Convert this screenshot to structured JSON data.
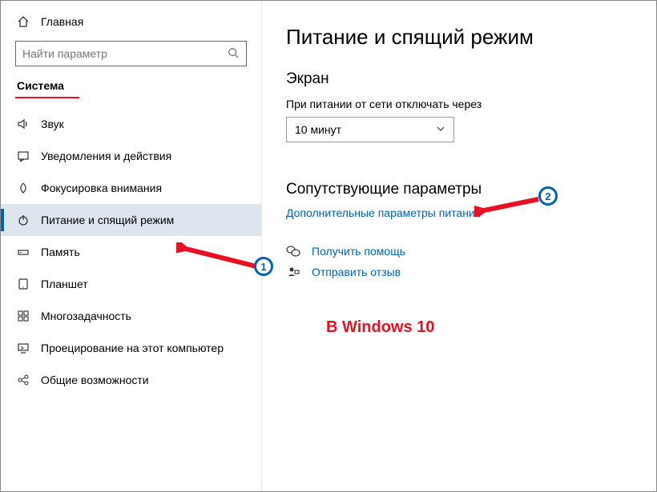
{
  "sidebar": {
    "home": "Главная",
    "search_placeholder": "Найти параметр",
    "section": "Система",
    "items": [
      {
        "icon": "sound-icon",
        "label": "Звук"
      },
      {
        "icon": "notifications-icon",
        "label": "Уведомления и действия"
      },
      {
        "icon": "focus-icon",
        "label": "Фокусировка внимания"
      },
      {
        "icon": "power-icon",
        "label": "Питание и спящий режим"
      },
      {
        "icon": "storage-icon",
        "label": "Память"
      },
      {
        "icon": "tablet-icon",
        "label": "Планшет"
      },
      {
        "icon": "multitask-icon",
        "label": "Многозадачность"
      },
      {
        "icon": "project-icon",
        "label": "Проецирование на этот компьютер"
      },
      {
        "icon": "shared-icon",
        "label": "Общие возможности"
      }
    ]
  },
  "main": {
    "title": "Питание и спящий режим",
    "screen_heading": "Экран",
    "screen_label": "При питании от сети отключать через",
    "screen_value": "10 минут",
    "related_heading": "Сопутствующие параметры",
    "related_link": "Дополнительные параметры питания",
    "help_link": "Получить помощь",
    "feedback_link": "Отправить отзыв",
    "watermark": "В Windows 10"
  },
  "annotations": {
    "callout1": "1",
    "callout2": "2"
  }
}
